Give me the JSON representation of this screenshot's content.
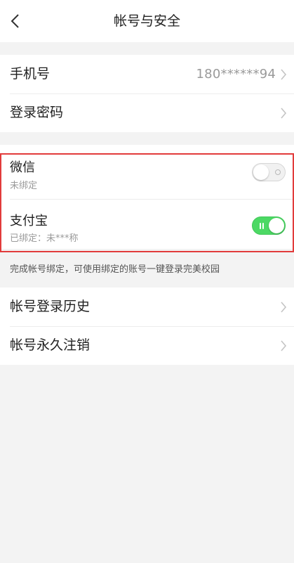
{
  "header": {
    "title": "帐号与安全",
    "back_icon": "chevron-left-icon"
  },
  "account_group": {
    "items": [
      {
        "label": "手机号",
        "value": "180******94"
      },
      {
        "label": "登录密码",
        "value": ""
      }
    ]
  },
  "binding_group": {
    "items": [
      {
        "name": "微信",
        "status": "未绑定",
        "enabled": false
      },
      {
        "name": "支付宝",
        "status": "已绑定：未***称",
        "enabled": true
      }
    ]
  },
  "note": "完成帐号绑定，可使用绑定的账号一键登录完美校园",
  "history_group": {
    "items": [
      {
        "label": "帐号登录历史"
      },
      {
        "label": "帐号永久注销"
      }
    ]
  },
  "colors": {
    "toggle_on": "#4cd964",
    "highlight": "#e23b3b"
  }
}
